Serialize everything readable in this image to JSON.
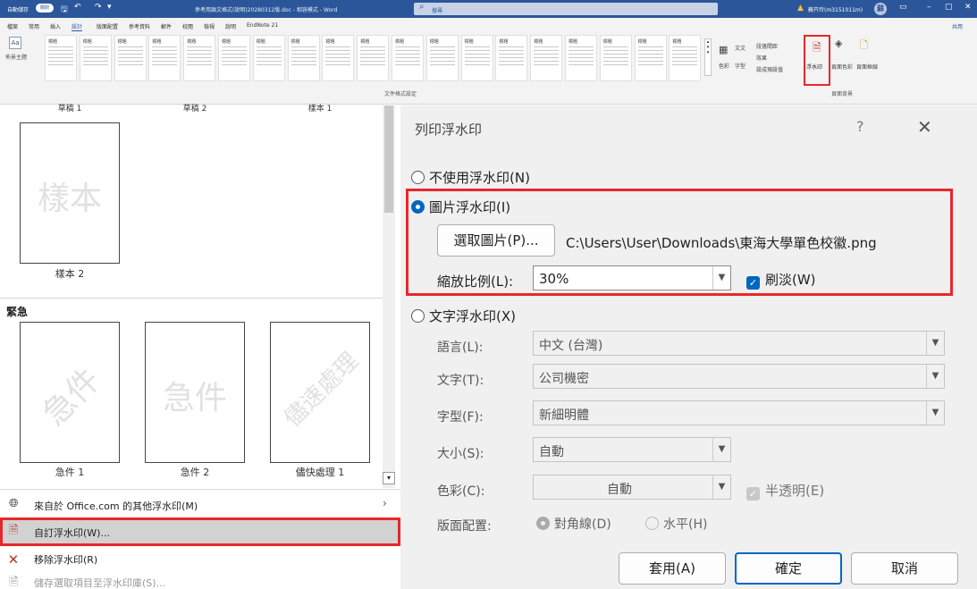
{
  "titlebar": {
    "autosave": "自動儲存",
    "autosave_state": "關閉",
    "doc_title": "參考用論文格式(說明)20280312版.doc - 相容模式 - Word",
    "search_placeholder": "搜尋",
    "user": "蘇卉玲(m3151011m)",
    "avatar": "蘇"
  },
  "tabs": [
    "檔案",
    "常用",
    "插入",
    "設計",
    "版面配置",
    "參考資料",
    "郵件",
    "校閱",
    "檢視",
    "說明",
    "EndNote 21"
  ],
  "active_tab": "設計",
  "share_label": "共用",
  "ribbon": {
    "theme_label": "佈景主題",
    "theme_icon_text": "Aa",
    "style_heading_labels": [
      "標題",
      "標題",
      "標題",
      "標題",
      "標題",
      "標題",
      "標題",
      "標題",
      "標題",
      "標題",
      "標題",
      "標題",
      "標題",
      "標題",
      "標題",
      "標題",
      "標題",
      "標題",
      "標題"
    ],
    "group_doc_format": "文件格式設定",
    "colors_label": "色彩",
    "fonts_label": "字型",
    "para_spacing": "段落間距",
    "effects": "效果",
    "set_default": "設成預設值",
    "watermark_btn": "浮水印",
    "page_color": "頁面色彩",
    "page_borders": "頁面框線",
    "group_page_bg": "頁面背景",
    "text_label": "文文"
  },
  "gallery": {
    "top_captions": [
      "草稿 1",
      "草稿 2",
      "樣本 1"
    ],
    "sample2_text": "樣本",
    "sample2_label": "樣本 2",
    "section_urgent": "緊急",
    "urgent": [
      {
        "text": "急件",
        "label": "急件 1"
      },
      {
        "text": "急件",
        "label": "急件 2"
      },
      {
        "text": "儘速處理",
        "label": "儘快處理 1"
      }
    ]
  },
  "menu": {
    "office_more": "來自於 Office.com 的其他浮水印(M)",
    "custom": "自訂浮水印(W)...",
    "remove": "移除浮水印(R)",
    "save_selection": "儲存選取項目至浮水印庫(S)..."
  },
  "dialog": {
    "title": "列印浮水印",
    "help": "?",
    "close": "✕",
    "no_watermark": "不使用浮水印(N)",
    "picture_watermark": "圖片浮水印(I)",
    "select_picture": "選取圖片(P)...",
    "picture_path": "C:\\Users\\User\\Downloads\\東海大學單色校徽.png",
    "scale_label": "縮放比例(L):",
    "scale_value": "30%",
    "washout": "刷淡(W)",
    "text_watermark": "文字浮水印(X)",
    "language_label": "語言(L):",
    "language_value": "中文 (台灣)",
    "text_label": "文字(T):",
    "text_value": "公司機密",
    "font_label": "字型(F):",
    "font_value": "新細明體",
    "size_label": "大小(S):",
    "size_value": "自動",
    "color_label": "色彩(C):",
    "color_value": "自動",
    "semitransparent": "半透明(E)",
    "layout_label": "版面配置:",
    "layout_diagonal": "對角線(D)",
    "layout_horizontal": "水平(H)",
    "apply": "套用(A)",
    "ok": "確定",
    "cancel": "取消"
  },
  "colors": {
    "accent": "#2b579a",
    "highlight_red": "#e8272b",
    "radio_blue": "#0067c0"
  }
}
